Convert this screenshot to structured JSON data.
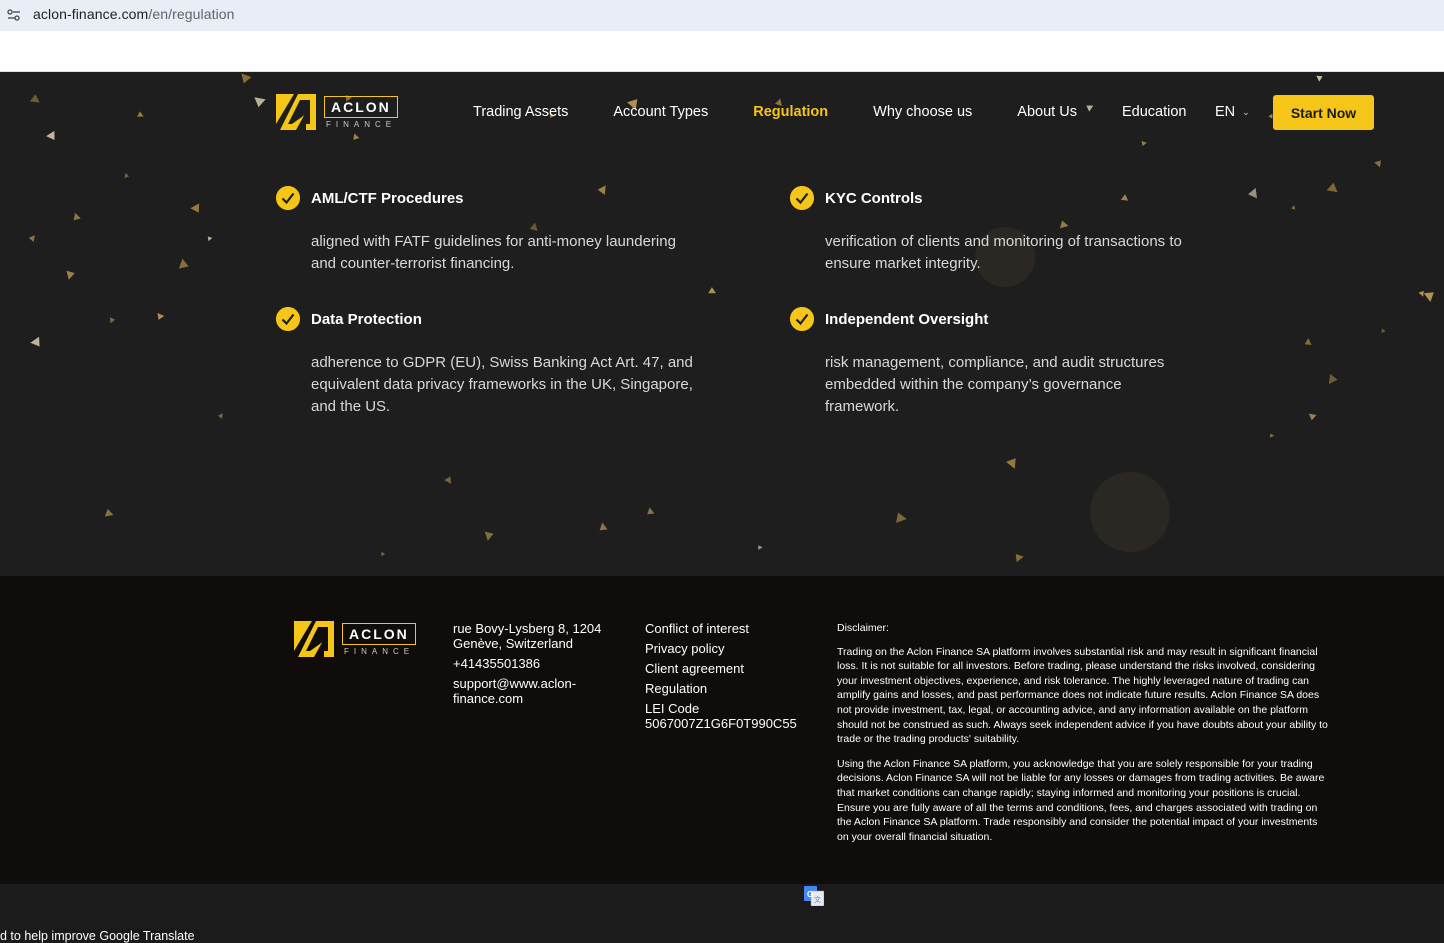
{
  "browser": {
    "url_domain": "aclon-finance.com",
    "url_path": "/en/regulation",
    "site_info_icon": "tune-icon"
  },
  "header": {
    "logo_text": "ACLON",
    "logo_sub": "FINANCE",
    "nav": [
      {
        "label": "Trading Assets"
      },
      {
        "label": "Account Types"
      },
      {
        "label": "Regulation",
        "active": true
      },
      {
        "label": "Why choose us"
      },
      {
        "label": "About Us"
      },
      {
        "label": "Education"
      }
    ],
    "language": "EN",
    "cta": "Start Now"
  },
  "features": [
    {
      "title": "AML/CTF Procedures",
      "desc": "aligned with FATF guidelines for anti-money laundering and counter-terrorist financing."
    },
    {
      "title": "KYC Controls",
      "desc": "verification of clients and monitoring of transactions to ensure market integrity."
    },
    {
      "title": "Data Protection",
      "desc": "adherence to GDPR (EU), Swiss Banking Act Art. 47, and equivalent data privacy frameworks in the UK, Singapore, and the US."
    },
    {
      "title": "Independent Oversight",
      "desc": "risk management, compliance, and audit structures embedded within the company’s governance framework."
    }
  ],
  "footer": {
    "address": "rue Bovy-Lysberg 8, 1204 Genève, Switzerland",
    "phone": "+41435501386",
    "email": "support@www.aclon-finance.com",
    "links": [
      "Conflict of interest",
      "Privacy policy",
      "Client agreement",
      "Regulation"
    ],
    "lei_label": "LEI Code",
    "lei_code": "5067007Z1G6F0T990C55",
    "disclaimer_title": "Disclaimer:",
    "disclaimer_p1": "Trading on the Aclon Finance SA platform involves substantial risk and may result in significant financial loss. It is not suitable for all investors. Before trading, please understand the risks involved, considering your investment objectives, experience, and risk tolerance. The highly leveraged nature of trading can amplify gains and losses, and past performance does not indicate future results. Aclon Finance SA does not provide investment, tax, legal, or accounting advice, and any information available on the platform should not be construed as such. Always seek independent advice if you have doubts about your ability to trade or the trading products' suitability.",
    "disclaimer_p2": "Using the Aclon Finance SA platform, you acknowledge that you are solely responsible for your trading decisions. Aclon Finance SA will not be liable for any losses or damages from trading activities. Be aware that market conditions can change rapidly; staying informed and monitoring your positions is crucial. Ensure you are fully aware of all the terms and conditions, fees, and charges associated with trading on the Aclon Finance SA platform. Trade responsibly and consider the potential impact of your investments on your overall financial situation."
  },
  "translate_bar": {
    "text": "d to help improve Google Translate",
    "icon": "google-translate-icon"
  },
  "colors": {
    "accent": "#f5c518",
    "background": "#1e1e1f",
    "footer_bg": "#0f0c09"
  }
}
